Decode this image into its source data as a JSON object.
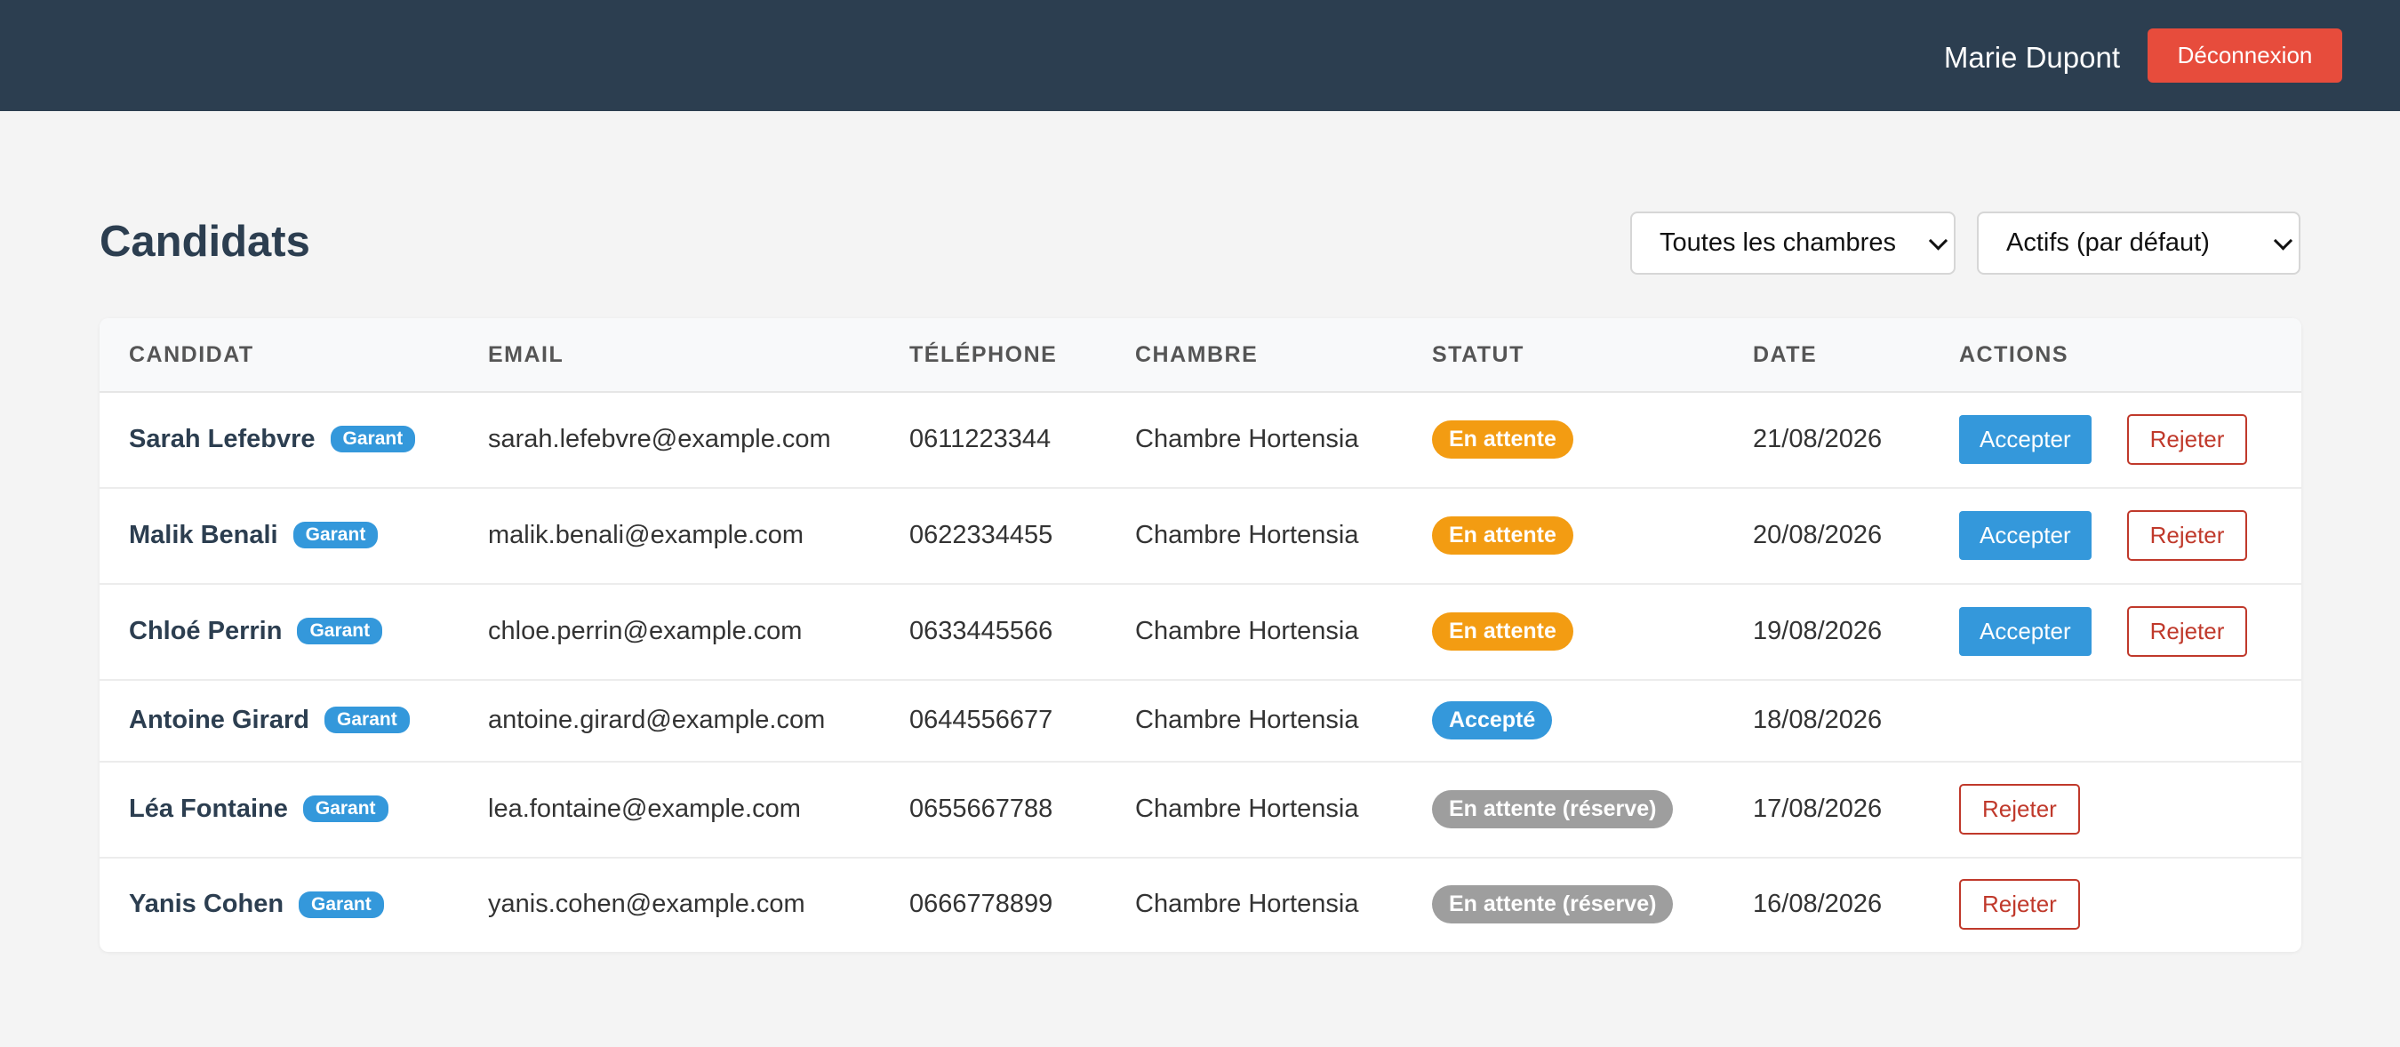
{
  "header": {
    "user_name": "Marie Dupont",
    "logout_label": "Déconnexion"
  },
  "page": {
    "title": "Candidats"
  },
  "filters": {
    "room": "Toutes les chambres",
    "status": "Actifs (par défaut)"
  },
  "table": {
    "columns": [
      "CANDIDAT",
      "EMAIL",
      "TÉLÉPHONE",
      "CHAMBRE",
      "STATUT",
      "DATE",
      "ACTIONS"
    ],
    "rows": [
      {
        "name": "Sarah Lefebvre",
        "badge": "Garant",
        "email": "sarah.lefebvre@example.com",
        "phone": "0611223344",
        "room": "Chambre Hortensia",
        "status": "En attente",
        "date": "21/08/2026",
        "accept_label": "Accepter",
        "reject_label": "Rejeter"
      },
      {
        "name": "Malik Benali",
        "badge": "Garant",
        "email": "malik.benali@example.com",
        "phone": "0622334455",
        "room": "Chambre Hortensia",
        "status": "En attente",
        "date": "20/08/2026",
        "accept_label": "Accepter",
        "reject_label": "Rejeter"
      },
      {
        "name": "Chloé Perrin",
        "badge": "Garant",
        "email": "chloe.perrin@example.com",
        "phone": "0633445566",
        "room": "Chambre Hortensia",
        "status": "En attente",
        "date": "19/08/2026",
        "accept_label": "Accepter",
        "reject_label": "Rejeter"
      },
      {
        "name": "Antoine Girard",
        "badge": "Garant",
        "email": "antoine.girard@example.com",
        "phone": "0644556677",
        "room": "Chambre Hortensia",
        "status": "Accepté",
        "date": "18/08/2026"
      },
      {
        "name": "Léa Fontaine",
        "badge": "Garant",
        "email": "lea.fontaine@example.com",
        "phone": "0655667788",
        "room": "Chambre Hortensia",
        "status": "En attente (réserve)",
        "date": "17/08/2026",
        "reject_label": "Rejeter"
      },
      {
        "name": "Yanis Cohen",
        "badge": "Garant",
        "email": "yanis.cohen@example.com",
        "phone": "0666778899",
        "room": "Chambre Hortensia",
        "status": "En attente (réserve)",
        "date": "16/08/2026",
        "reject_label": "Rejeter"
      }
    ]
  },
  "colors": {
    "header_bg": "#2c3e50",
    "logout": "#e74c3c",
    "accept": "#3498db",
    "reject": "#c0392b",
    "status_pending": "#f39c12",
    "status_accepted": "#3498db",
    "status_reserve": "#95a5a6"
  }
}
